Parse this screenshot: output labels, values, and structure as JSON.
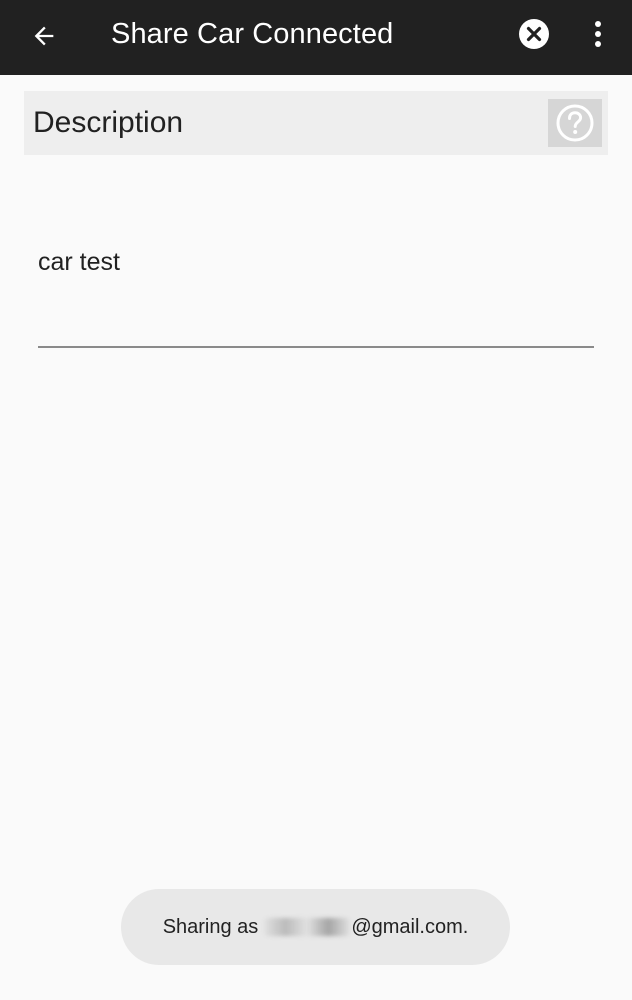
{
  "app_bar": {
    "title": "Share Car Connected",
    "back_icon": "arrow-back-icon",
    "close_icon": "close-circle-icon",
    "more_icon": "more-vert-icon",
    "background": "#212121"
  },
  "description": {
    "label": "Description",
    "help_icon": "help-circle-icon"
  },
  "field": {
    "value": "car test"
  },
  "toast": {
    "prefix": "Sharing as",
    "suffix": "@gmail.com."
  }
}
